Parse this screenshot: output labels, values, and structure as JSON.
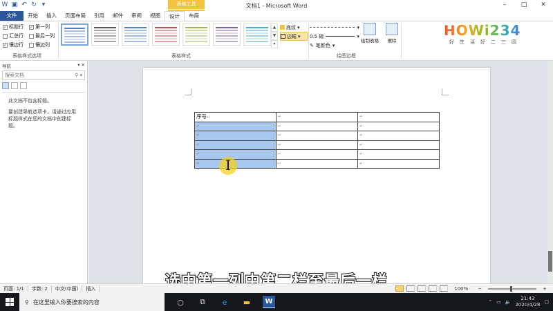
{
  "window": {
    "title": "文档1 - Microsoft Word",
    "context_tool_title": "表格工具",
    "controls": [
      "–",
      "□",
      "✕"
    ]
  },
  "ribbon_tabs": [
    "文件",
    "开始",
    "插入",
    "页面布局",
    "引用",
    "邮件",
    "审阅",
    "视图",
    "设计",
    "布局"
  ],
  "table_style_options": {
    "items": [
      {
        "label": "标题行",
        "checked": true
      },
      {
        "label": "第一列",
        "checked": true
      },
      {
        "label": "汇总行",
        "checked": false
      },
      {
        "label": "最后一列",
        "checked": false
      },
      {
        "label": "镶边行",
        "checked": true
      },
      {
        "label": "镶边列",
        "checked": false
      }
    ],
    "group_label": "表格样式选项"
  },
  "table_styles": {
    "group_label": "表格样式",
    "colors": [
      "#5a7fbd",
      "#555555",
      "#4f81bd",
      "#c0504d",
      "#9bbb59",
      "#8064a2",
      "#4bacc6"
    ]
  },
  "shading": {
    "label": "底纹",
    "border_label": "边框"
  },
  "pen": {
    "weight": "0.5 磅",
    "color_label": "笔颜色"
  },
  "draw_borders": {
    "draw_table": "绘制表格",
    "eraser": "擦除",
    "group_label": "绘图边框"
  },
  "logo": {
    "text": "ᕼOWi234",
    "tagline": "好生活好二三四"
  },
  "nav_pane": {
    "title": "导航",
    "search_placeholder": "搜索文档",
    "no_headings": "此文档不包含标题。",
    "hint": "要创建导航选项卡，请通过应用标题样式在您的文档中创建标题。"
  },
  "document": {
    "header_cell": "序号"
  },
  "subtitle": "选中第一列中第二栏至最后一栏",
  "status": {
    "page": "页面: 1/1",
    "words": "字数: 2",
    "language": "中文(中国)",
    "mode": "插入",
    "zoom": "100%"
  },
  "taskbar": {
    "search_placeholder": "在这里输入你要搜索的内容",
    "time": "21:43",
    "date": "2020/4/28"
  }
}
